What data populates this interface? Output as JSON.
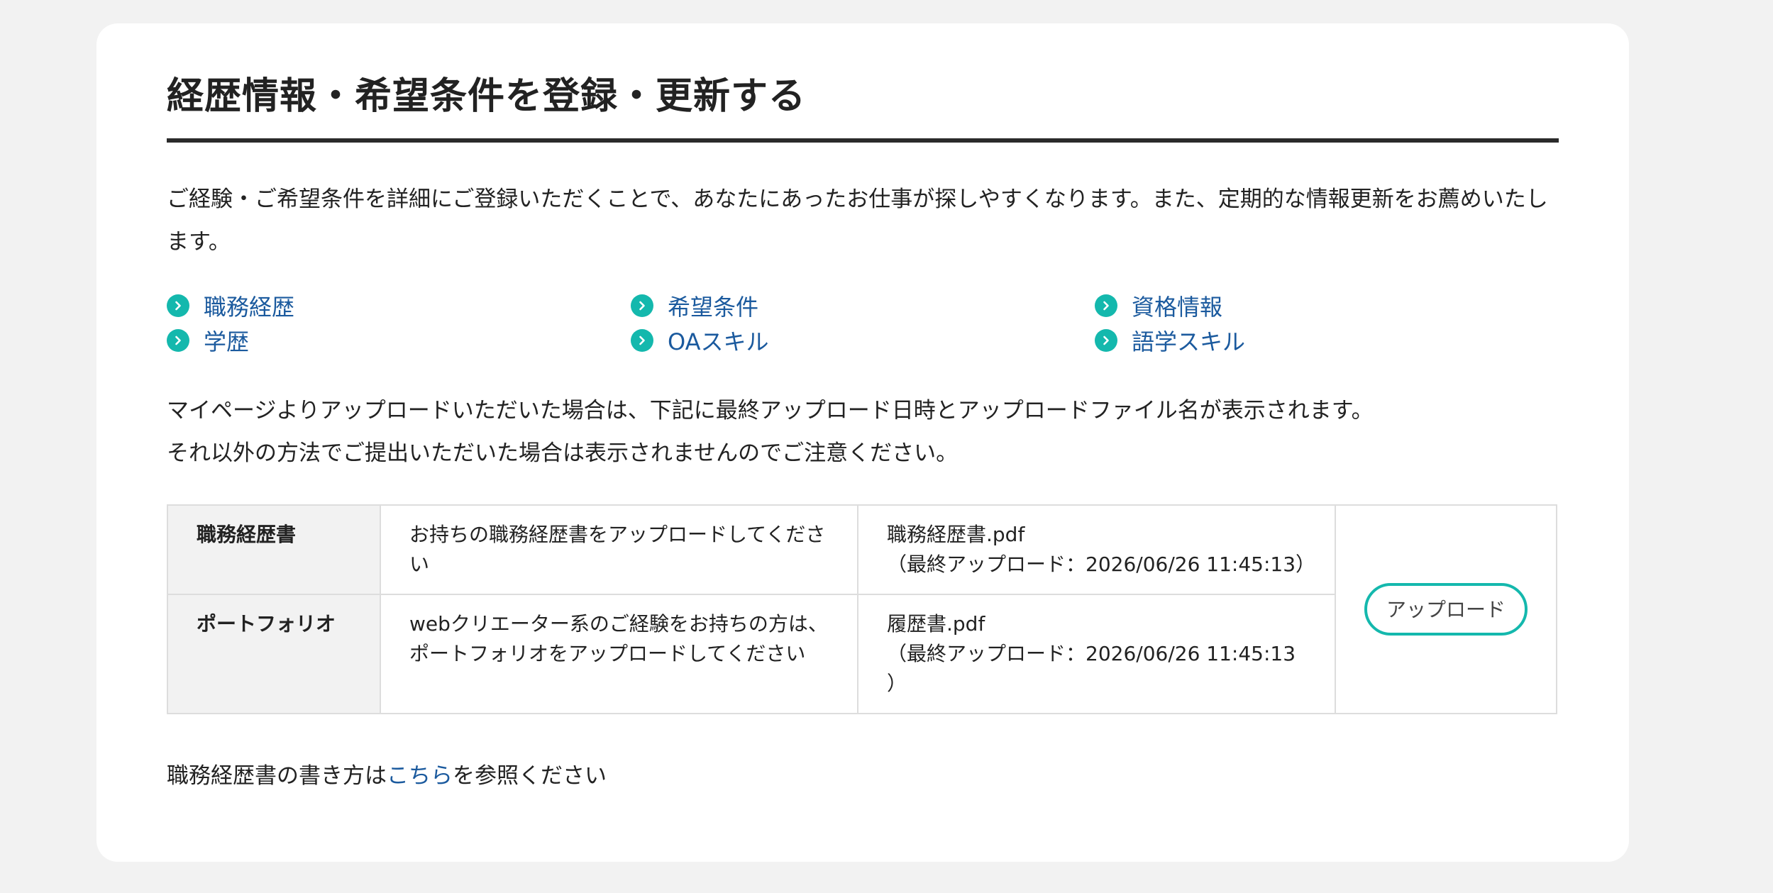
{
  "section": {
    "title": "経歴情報・希望条件を登録・更新する",
    "intro": "ご経験・ご希望条件を詳細にご登録いただくことで、あなたにあったお仕事が探しやすくなります。また、定期的な情報更新をお薦めいたします。"
  },
  "links": [
    {
      "label": "職務経歴",
      "icon": "chevron-right-icon"
    },
    {
      "label": "希望条件",
      "icon": "chevron-right-icon"
    },
    {
      "label": "資格情報",
      "icon": "chevron-right-icon"
    },
    {
      "label": "学歴",
      "icon": "chevron-right-icon"
    },
    {
      "label": "OAスキル",
      "icon": "chevron-right-icon"
    },
    {
      "label": "語学スキル",
      "icon": "chevron-right-icon"
    }
  ],
  "upload_note": {
    "line1": "マイページよりアップロードいただいた場合は、下記に最終アップロード日時とアップロードファイル名が表示されます。",
    "line2": "それ以外の方法でご提出いただいた場合は表示されませんのでご注意ください。"
  },
  "files": [
    {
      "label": "職務経歴書",
      "description": "お持ちの職務経歴書をアップロードしてください",
      "filename": "職務経歴書.pdf",
      "last_upload": "（最終アップロード：2026/06/26 11:45:13）"
    },
    {
      "label": "ポートフォリオ",
      "description": "webクリエーター系のご経験をお持ちの方は、ポートフォリオをアップロードしてください",
      "filename": "履歴書.pdf",
      "last_upload": "（最終アップロード：2026/06/26 11:45:13 ）"
    }
  ],
  "upload_button": "アップロード",
  "footer": {
    "before": "職務経歴書の書き方は",
    "link": "こちら",
    "after": "を参照ください"
  },
  "colors": {
    "accent": "#14b8ad",
    "link": "#1b5a9e",
    "background": "#f2f2f2"
  }
}
